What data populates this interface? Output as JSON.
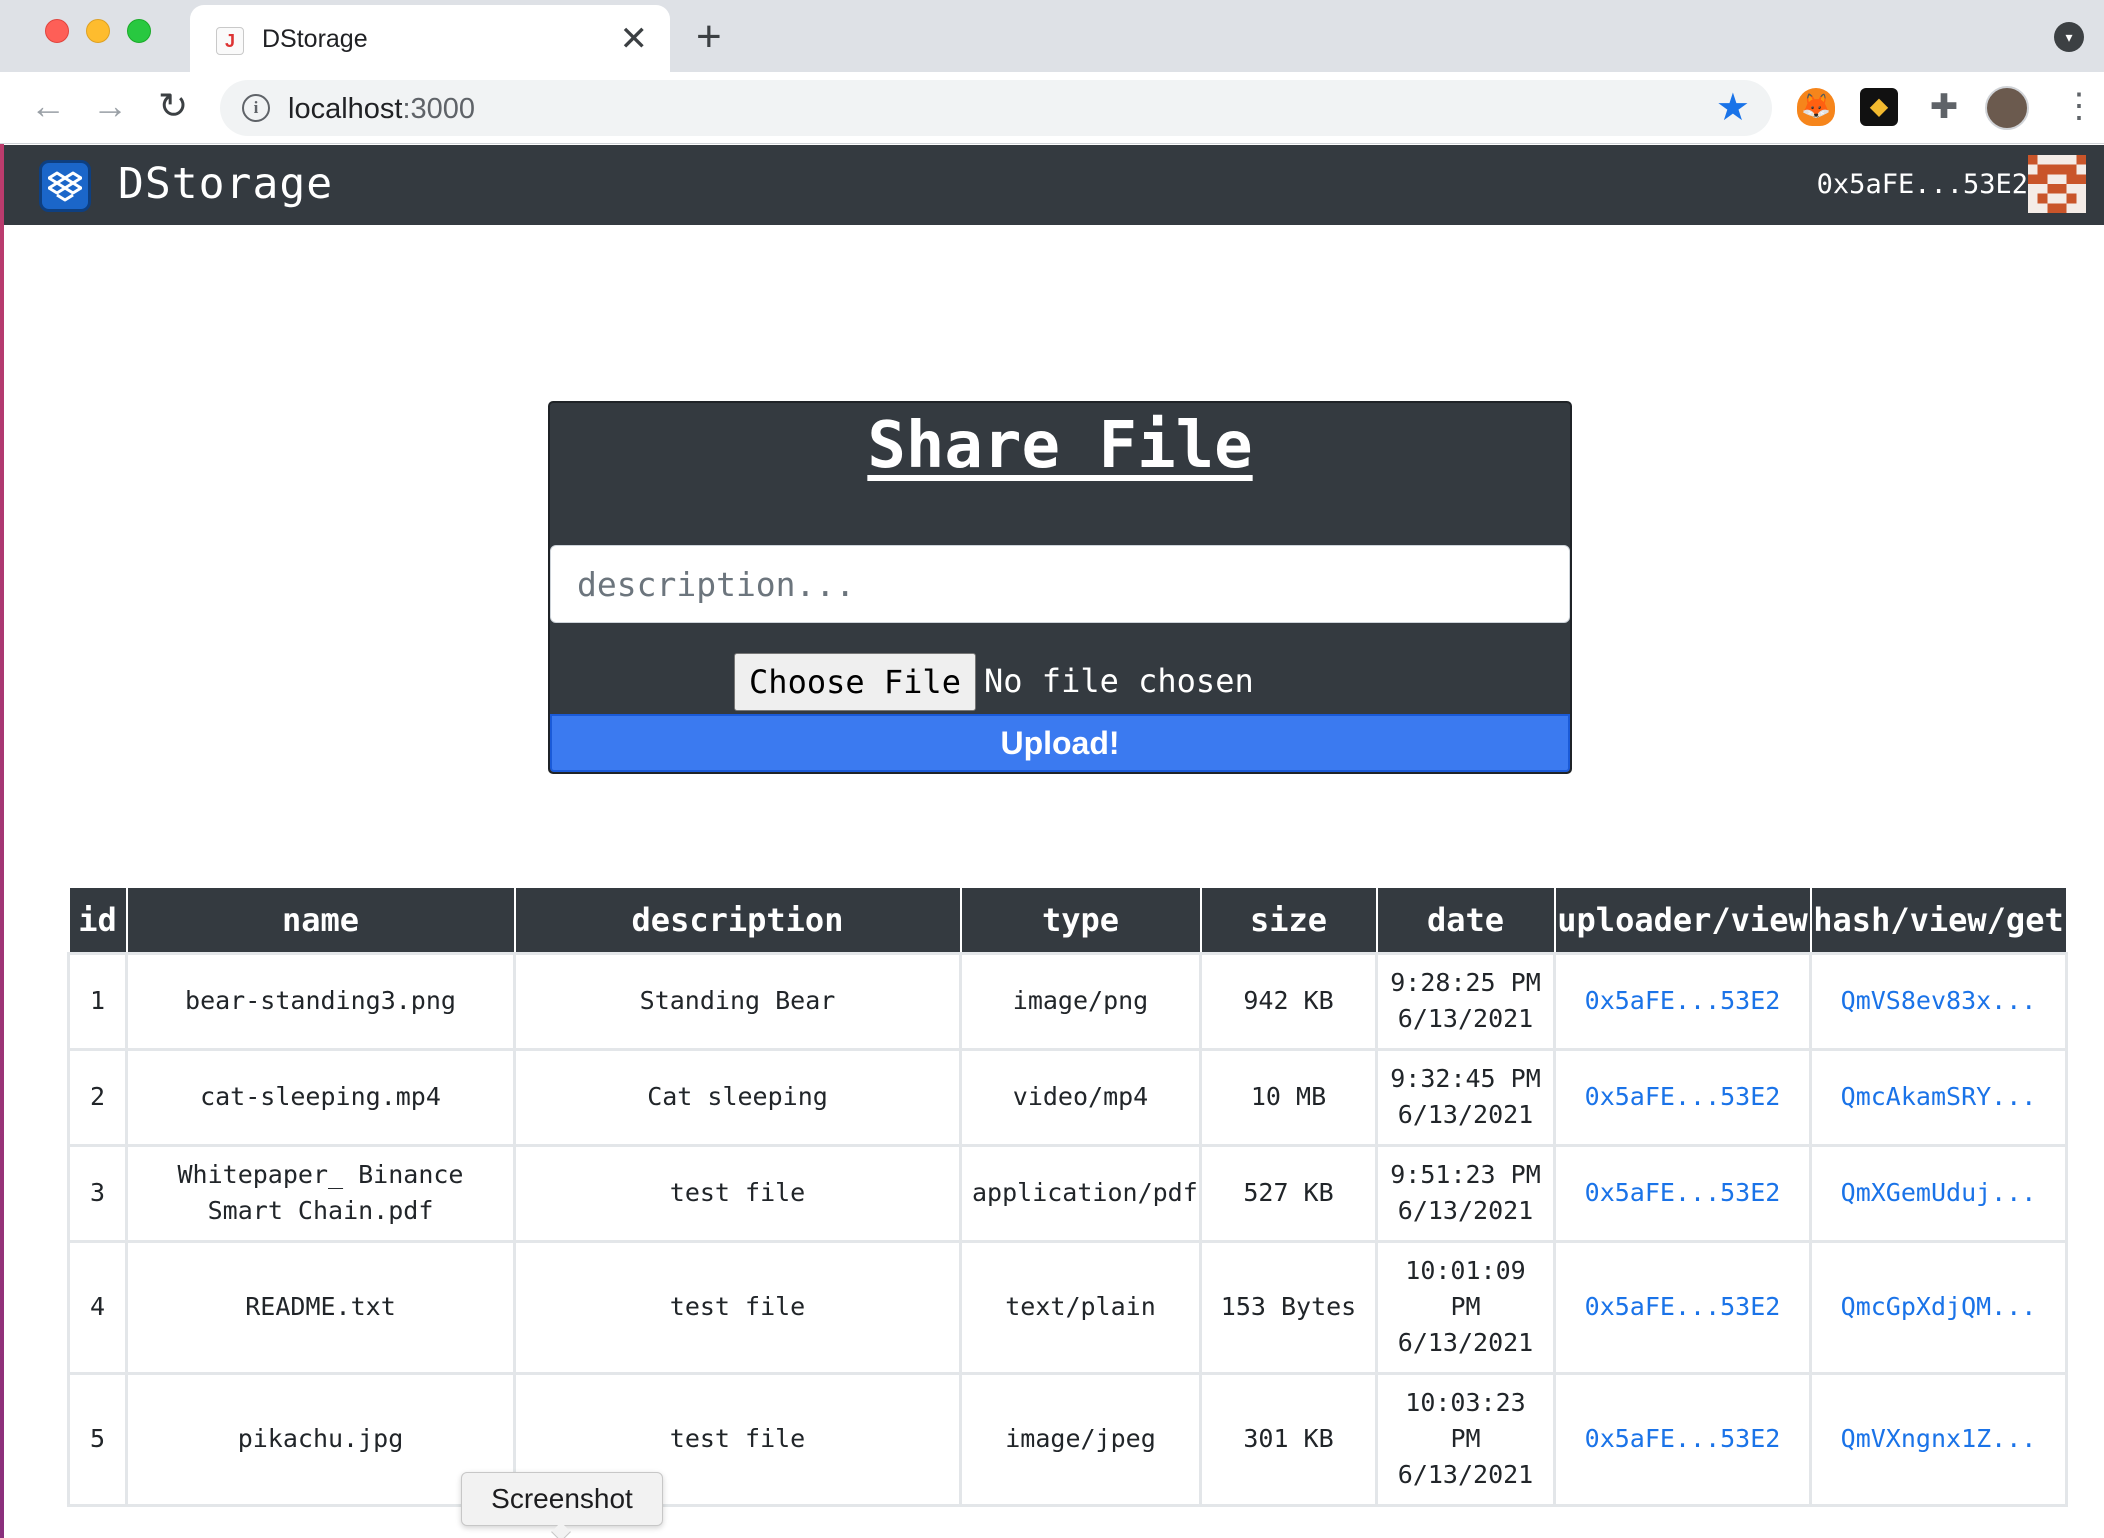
{
  "browser": {
    "tab_title": "DStorage",
    "tab_favicon": "J",
    "new_tab_symbol": "+",
    "close_symbol": "✕",
    "url_host": "localhost",
    "url_port": ":3000"
  },
  "navbar": {
    "app_name": "DStorage",
    "account": "0x5aFE...53E2"
  },
  "share_form": {
    "title": "Share File",
    "description_placeholder": "description...",
    "description_value": "",
    "choose_file_label": "Choose File",
    "file_status": "No file chosen",
    "upload_label": "Upload!"
  },
  "table": {
    "columns": [
      "id",
      "name",
      "description",
      "type",
      "size",
      "date",
      "uploader/view",
      "hash/view/get"
    ],
    "rows": [
      {
        "id": "1",
        "name": "bear-standing3.png",
        "description": "Standing Bear",
        "type": "image/png",
        "size": "942 KB",
        "time": "9:28:25 PM",
        "date": "6/13/2021",
        "uploader": "0x5aFE...53E2",
        "hash": "QmVS8ev83x..."
      },
      {
        "id": "2",
        "name": "cat-sleeping.mp4",
        "description": "Cat sleeping",
        "type": "video/mp4",
        "size": "10 MB",
        "time": "9:32:45 PM",
        "date": "6/13/2021",
        "uploader": "0x5aFE...53E2",
        "hash": "QmcAkamSRY..."
      },
      {
        "id": "3",
        "name": "Whitepaper_ Binance Smart Chain.pdf",
        "description": "test file",
        "type": "application/pdf",
        "size": "527 KB",
        "time": "9:51:23 PM",
        "date": "6/13/2021",
        "uploader": "0x5aFE...53E2",
        "hash": "QmXGemUduj..."
      },
      {
        "id": "4",
        "name": "README.txt",
        "description": "test file",
        "type": "text/plain",
        "size": "153 Bytes",
        "time": "10:01:09 PM",
        "date": "6/13/2021",
        "uploader": "0x5aFE...53E2",
        "hash": "QmcGpXdjQM..."
      },
      {
        "id": "5",
        "name": "pikachu.jpg",
        "description": "test file",
        "type": "image/jpeg",
        "size": "301 KB",
        "time": "10:03:23 PM",
        "date": "6/13/2021",
        "uploader": "0x5aFE...53E2",
        "hash": "QmVXngnx1Z..."
      }
    ]
  },
  "tooltip": {
    "text": "Screenshot"
  },
  "colors": {
    "navbar_bg": "#343a40",
    "upload_button": "#3b7af0",
    "link": "#1a73e8"
  },
  "icons": {
    "back": "arrow-left-icon",
    "forward": "arrow-right-icon",
    "reload": "reload-icon",
    "site_info": "info-icon",
    "bookmark": "star-icon",
    "extension_1": "metamask-fox-icon",
    "extension_2": "binance-wallet-icon",
    "extensions": "puzzle-icon",
    "menu": "kebab-menu-icon",
    "app_logo": "dropbox-logo-icon"
  }
}
